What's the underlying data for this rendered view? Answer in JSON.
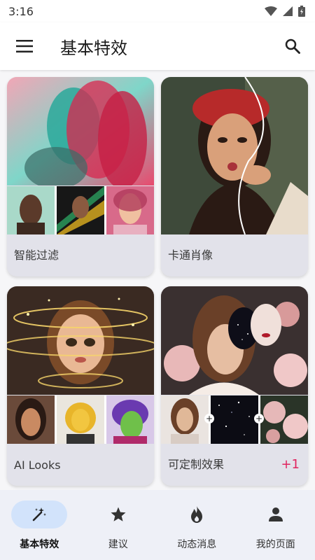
{
  "status_bar": {
    "time": "3:16"
  },
  "app_bar": {
    "title": "基本特效"
  },
  "cards": [
    {
      "label": "智能过滤",
      "badge": ""
    },
    {
      "label": "卡通肖像",
      "badge": ""
    },
    {
      "label": "AI Looks",
      "badge": ""
    },
    {
      "label": "可定制效果",
      "badge": "+1"
    }
  ],
  "bottom_nav": {
    "items": [
      {
        "label": "基本特效",
        "icon": "magic-wand-icon",
        "active": true
      },
      {
        "label": "建议",
        "icon": "star-icon",
        "active": false
      },
      {
        "label": "动态消息",
        "icon": "flame-icon",
        "active": false
      },
      {
        "label": "我的页面",
        "icon": "person-icon",
        "active": false
      }
    ]
  },
  "colors": {
    "accent_badge": "#e0245e",
    "nav_active_pill": "#d2e3fb",
    "nav_background": "#eef0f7",
    "card_background": "#e2e2ea"
  }
}
